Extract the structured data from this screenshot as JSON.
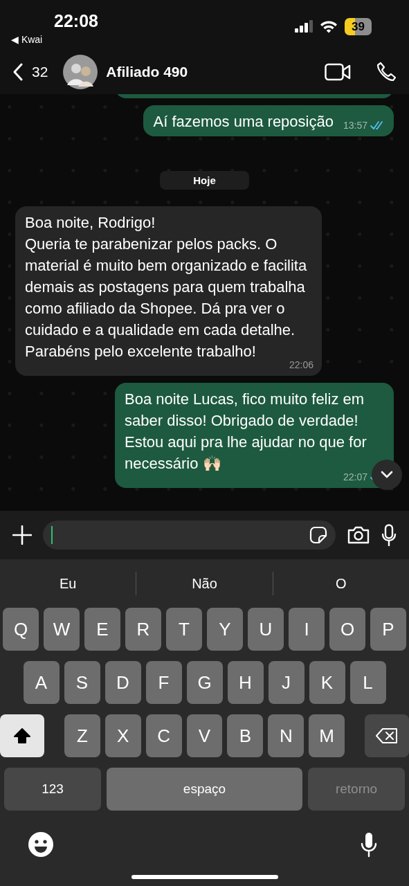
{
  "status_bar": {
    "time": "22:08",
    "back_app": "◀ Kwai",
    "battery": "39"
  },
  "header": {
    "unread_count": "32",
    "contact_name": "Afiliado 490"
  },
  "messages": [
    {
      "kind": "out",
      "partial": true
    },
    {
      "kind": "out",
      "text": "Aí fazemos uma reposição",
      "time": "13:57",
      "read": true
    },
    {
      "kind": "date",
      "text": "Hoje"
    },
    {
      "kind": "in",
      "text": "Boa noite, Rodrigo!\nQueria te parabenizar pelos packs. O material é muito bem organizado e facilita demais as postagens para quem trabalha como afiliado da Shopee. Dá pra ver o cuidado e a qualidade em cada detalhe.\nParabéns pelo excelente trabalho!",
      "time": "22:06"
    },
    {
      "kind": "out",
      "text": "Boa noite Lucas, fico muito feliz em saber disso! Obrigado de verdade! Estou aqui pra lhe ajudar no que for necessário 🙌🏻",
      "time": "22:07",
      "read": true
    }
  ],
  "composer": {
    "has_cursor": true
  },
  "keyboard": {
    "suggestions": [
      "Eu",
      "Não",
      "O"
    ],
    "rows": [
      [
        "Q",
        "W",
        "E",
        "R",
        "T",
        "Y",
        "U",
        "I",
        "O",
        "P"
      ],
      [
        "A",
        "S",
        "D",
        "F",
        "G",
        "H",
        "J",
        "K",
        "L"
      ],
      [
        "Z",
        "X",
        "C",
        "V",
        "B",
        "N",
        "M"
      ]
    ],
    "shift_on": true,
    "numbers_key": "123",
    "space_key": "espaço",
    "return_key": "retorno",
    "return_disabled": true
  }
}
